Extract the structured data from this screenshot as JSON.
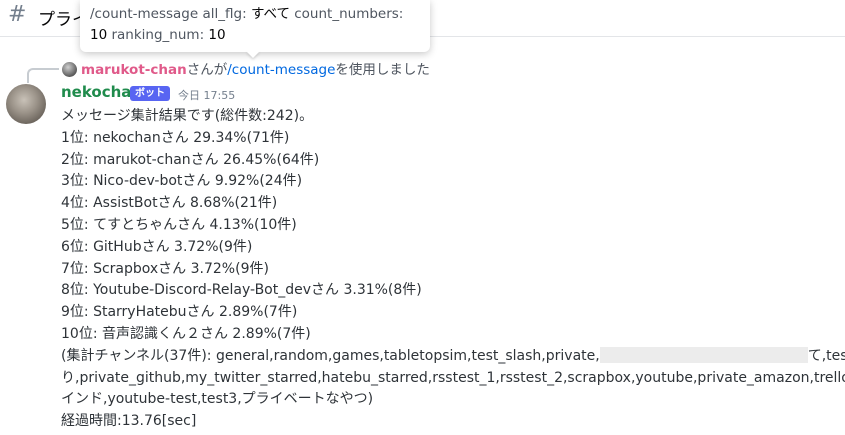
{
  "header": {
    "channel_name": "プライ"
  },
  "tooltip": {
    "command": "/count-message",
    "opt1_key": "all_flg:",
    "opt1_value": "すべて",
    "opt2_key": "count_numbers:",
    "opt2_value": "10",
    "opt3_key": "ranking_num:",
    "opt3_value": "10"
  },
  "reply": {
    "user": "marukot-chan",
    "mid_text": "さんが",
    "command": "/count-message",
    "suffix": "を使用しました"
  },
  "message": {
    "author": "nekochan",
    "bot_tag": "ボット",
    "timestamp": "今日 17:55",
    "summary": "メッセージ集計結果です(総件数:242)。",
    "ranking": [
      "1位: nekochanさん 29.34%(71件)",
      "2位: marukot-chanさん 26.45%(64件)",
      "3位: Nico-dev-botさん 9.92%(24件)",
      "4位: AssistBotさん 8.68%(21件)",
      "5位: てすとちゃんさん 4.13%(10件)",
      "6位: GitHubさん 3.72%(9件)",
      "7位: Scrapboxさん 3.72%(9件)",
      "8位: Youtube-Discord-Relay-Bot_devさん 3.31%(8件)",
      "9位: StarryHatebuさん 2.89%(7件)",
      "10位: 音声認識くん２さん 2.89%(7件)"
    ],
    "channels_prefix": "(集計チャンネル(37件): general,random,games,tabletopsim,test_slash,private,",
    "channels_after_redact": "て,test,",
    "channels_line2": "り,private_github,my_twitter_starred,hatebu_starred,rsstest_1,rsstest_2,scrapbox,youtube,private_amazon,trello_test",
    "channels_line3": "インド,youtube-test,test3,プライベートなやつ)",
    "elapsed": "経過時間:13.76[sec]"
  }
}
